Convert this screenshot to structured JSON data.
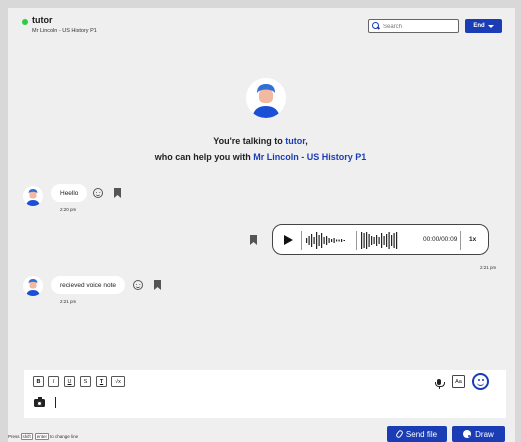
{
  "header": {
    "tutor_name": "tutor",
    "subtitle": "Mr Lincoln - US History P1",
    "search_placeholder": "Search",
    "end_label": "End",
    "status_color": "#2ecc40"
  },
  "intro": {
    "line1_prefix": "You're talking to ",
    "line1_name": "tutor",
    "line1_suffix": ",",
    "line2_prefix": "who can help you with ",
    "line2_subject": "Mr Lincoln - US History P1"
  },
  "messages": [
    {
      "text": "Heello",
      "time": "2:20 pm"
    },
    {
      "type": "voice",
      "duration": "00:00/00:09",
      "speed": "1x",
      "time": "2:21 pm"
    },
    {
      "text": "recieved voice note",
      "time": "2:21 pm"
    }
  ],
  "composer": {
    "format_buttons": [
      "B",
      "I",
      "U",
      "S",
      "T",
      "√x"
    ],
    "aa_label": "Aa"
  },
  "footer": {
    "hint_press": "Press",
    "hint_key1": "shift",
    "hint_key2": "enter",
    "hint_suffix": "to change line",
    "send_label": "Send file",
    "draw_label": "Draw"
  },
  "colors": {
    "accent": "#1a3db5",
    "background": "#efefef"
  }
}
